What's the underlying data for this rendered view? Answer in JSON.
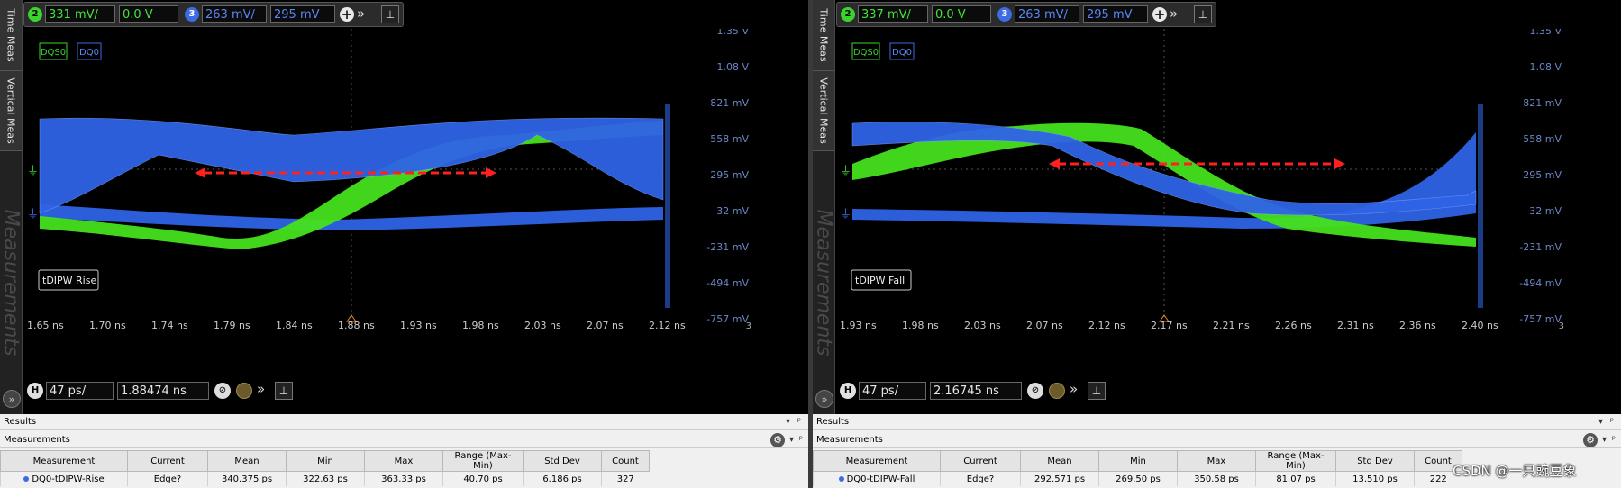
{
  "tabs": [
    "Time Meas",
    "Vertical Meas",
    "Measurements"
  ],
  "colors": {
    "ch2": "#3bd42e",
    "ch3": "#3d6be0",
    "marker": "#ff2020",
    "bg": "#000000"
  },
  "panels": [
    {
      "ch2_badge": "2",
      "ch2_scale": "331 mV/",
      "ch2_offset": "0.0 V",
      "ch3_badge": "3",
      "ch3_scale": "263 mV/",
      "ch3_offset": "295 mV",
      "legend": [
        "DQS0",
        "DQ0"
      ],
      "yticks": [
        "1.35 V",
        "1.08 V",
        "821 mV",
        "558 mV",
        "295 mV",
        "32 mV",
        "-231 mV",
        "-494 mV",
        "-757 mV"
      ],
      "xticks": [
        "1.65 ns",
        "1.70 ns",
        "1.74 ns",
        "1.79 ns",
        "1.84 ns",
        "1.88 ns",
        "1.93 ns",
        "1.98 ns",
        "2.03 ns",
        "2.07 ns",
        "2.12 ns"
      ],
      "corner_label": "3",
      "annotation": "tDIPW Rise",
      "h_badge": "H",
      "h_scale": "47 ps/",
      "h_pos": "1.88474 ns",
      "results_title": "Results",
      "meas_title": "Measurements",
      "headers": [
        "Measurement",
        "Current",
        "Mean",
        "Min",
        "Max",
        "Range (Max-Min)",
        "Std Dev",
        "Count"
      ],
      "row": [
        "DQ0-tDIPW-Rise",
        "Edge?",
        "340.375 ps",
        "322.63 ps",
        "363.33 ps",
        "40.70 ps",
        "6.186 ps",
        "327"
      ]
    },
    {
      "ch2_badge": "2",
      "ch2_scale": "337 mV/",
      "ch2_offset": "0.0 V",
      "ch3_badge": "3",
      "ch3_scale": "263 mV/",
      "ch3_offset": "295 mV",
      "legend": [
        "DQS0",
        "DQ0"
      ],
      "yticks": [
        "1.35 V",
        "1.08 V",
        "821 mV",
        "558 mV",
        "295 mV",
        "32 mV",
        "-231 mV",
        "-494 mV",
        "-757 mV"
      ],
      "xticks": [
        "1.93 ns",
        "1.98 ns",
        "2.03 ns",
        "2.07 ns",
        "2.12 ns",
        "2.17 ns",
        "2.21 ns",
        "2.26 ns",
        "2.31 ns",
        "2.36 ns",
        "2.40 ns"
      ],
      "corner_label": "3",
      "annotation": "tDIPW Fall",
      "h_badge": "H",
      "h_scale": "47 ps/",
      "h_pos": "2.16745 ns",
      "results_title": "Results",
      "meas_title": "Measurements",
      "headers": [
        "Measurement",
        "Current",
        "Mean",
        "Min",
        "Max",
        "Range (Max-Min)",
        "Std Dev",
        "Count"
      ],
      "row": [
        "DQ0-tDIPW-Fall",
        "Edge?",
        "292.571 ps",
        "269.50 ps",
        "350.58 ps",
        "81.07 ps",
        "13.510 ps",
        "222"
      ]
    }
  ],
  "watermark": "CSDN @一只豌豆象"
}
